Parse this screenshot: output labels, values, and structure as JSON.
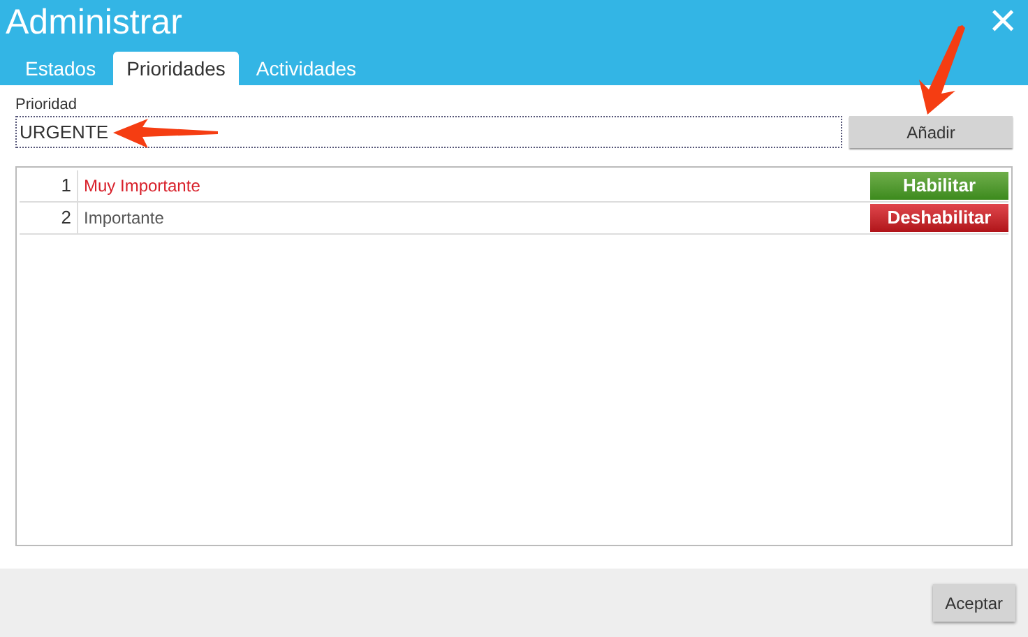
{
  "window": {
    "title": "Administrar",
    "close": "×"
  },
  "tabs": [
    {
      "label": "Estados",
      "selected": false
    },
    {
      "label": "Prioridades",
      "selected": true
    },
    {
      "label": "Actividades",
      "selected": false
    }
  ],
  "form": {
    "label": "Prioridad",
    "value": "URGENTE",
    "add_button": "Añadir"
  },
  "rows": [
    {
      "number": "1",
      "name": "Muy Importante",
      "disabled": true,
      "action": "Habilitar"
    },
    {
      "number": "2",
      "name": "Importante",
      "disabled": false,
      "action": "Deshabilitar"
    }
  ],
  "footer": {
    "button": "Aceptar"
  }
}
